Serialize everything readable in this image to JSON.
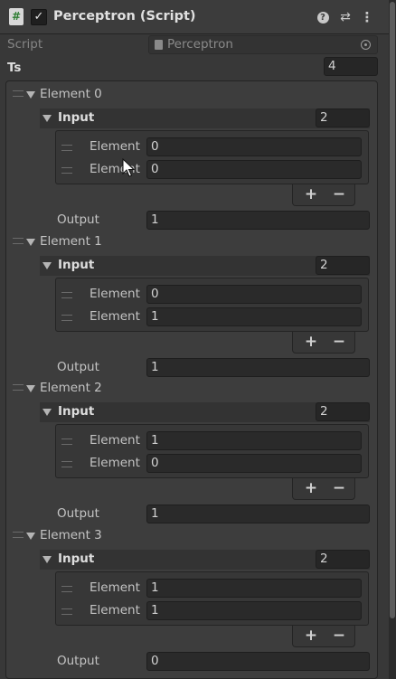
{
  "component": {
    "title": "Perceptron (Script)",
    "enabled": true,
    "icon": "csharp-script-icon",
    "header_icons": [
      "help-icon",
      "preset-icon",
      "context-menu-icon"
    ]
  },
  "script_row": {
    "label": "Script",
    "value": "Perceptron"
  },
  "ts": {
    "label": "Ts",
    "size": "4"
  },
  "elements": [
    {
      "label": "Element 0",
      "input_label": "Input",
      "input_size": "2",
      "items": [
        {
          "label": "Element",
          "value": "0"
        },
        {
          "label": "Element",
          "value": "0"
        }
      ],
      "output_label": "Output",
      "output_value": "1"
    },
    {
      "label": "Element 1",
      "input_label": "Input",
      "input_size": "2",
      "items": [
        {
          "label": "Element",
          "value": "0"
        },
        {
          "label": "Element",
          "value": "1"
        }
      ],
      "output_label": "Output",
      "output_value": "1"
    },
    {
      "label": "Element 2",
      "input_label": "Input",
      "input_size": "2",
      "items": [
        {
          "label": "Element",
          "value": "1"
        },
        {
          "label": "Element",
          "value": "0"
        }
      ],
      "output_label": "Output",
      "output_value": "1"
    },
    {
      "label": "Element 3",
      "input_label": "Input",
      "input_size": "2",
      "items": [
        {
          "label": "Element",
          "value": "1"
        },
        {
          "label": "Element",
          "value": "1"
        }
      ],
      "output_label": "Output",
      "output_value": "0"
    }
  ],
  "list_buttons": {
    "add": "+",
    "remove": "−"
  }
}
